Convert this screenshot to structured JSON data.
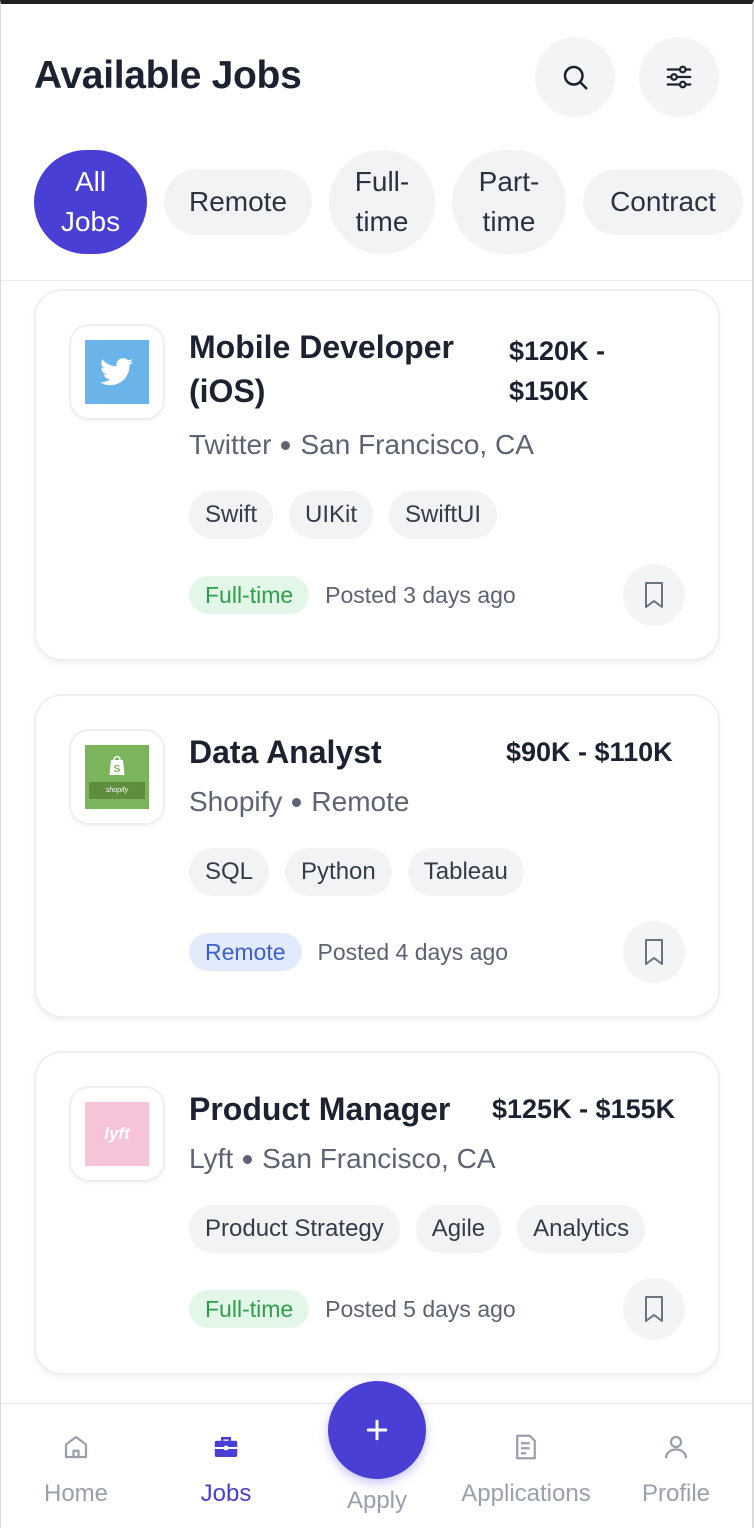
{
  "header": {
    "title": "Available Jobs",
    "search_icon": "search-icon",
    "filter_icon": "sliders-icon"
  },
  "filters": [
    {
      "label": "All Jobs",
      "active": true
    },
    {
      "label": "Remote",
      "active": false
    },
    {
      "label": "Full-time",
      "active": false
    },
    {
      "label": "Part-time",
      "active": false
    },
    {
      "label": "Contract",
      "active": false
    }
  ],
  "jobs": [
    {
      "title": "Mobile Developer (iOS)",
      "salary": "$120K - $150K",
      "company": "Twitter",
      "location": "San Francisco, CA",
      "tags": [
        "Swift",
        "UIKit",
        "SwiftUI"
      ],
      "type": "Full-time",
      "posted": "Posted 3 days ago",
      "logo_color": "#6ab4ea"
    },
    {
      "title": "Data Analyst",
      "salary": "$90K - $110K",
      "company": "Shopify",
      "location": "Remote",
      "tags": [
        "SQL",
        "Python",
        "Tableau"
      ],
      "type": "Remote",
      "posted": "Posted 4 days ago",
      "logo_color": "#7ab55c",
      "logo_text": "shopify"
    },
    {
      "title": "Product Manager",
      "salary": "$125K - $155K",
      "company": "Lyft",
      "location": "San Francisco, CA",
      "tags": [
        "Product Strategy",
        "Agile",
        "Analytics"
      ],
      "type": "Full-time",
      "posted": "Posted 5 days ago",
      "logo_color": "#f6c3d8",
      "logo_text": "lyft"
    }
  ],
  "nav": {
    "home": "Home",
    "jobs": "Jobs",
    "apply": "Apply",
    "applications": "Applications",
    "profile": "Profile",
    "active": "Jobs"
  },
  "colors": {
    "accent": "#4a3fd4",
    "fulltime_bg": "#e3f7e8",
    "fulltime_text": "#2f9e4c",
    "remote_bg": "#e2ebfb",
    "remote_text": "#3d5fd1"
  }
}
